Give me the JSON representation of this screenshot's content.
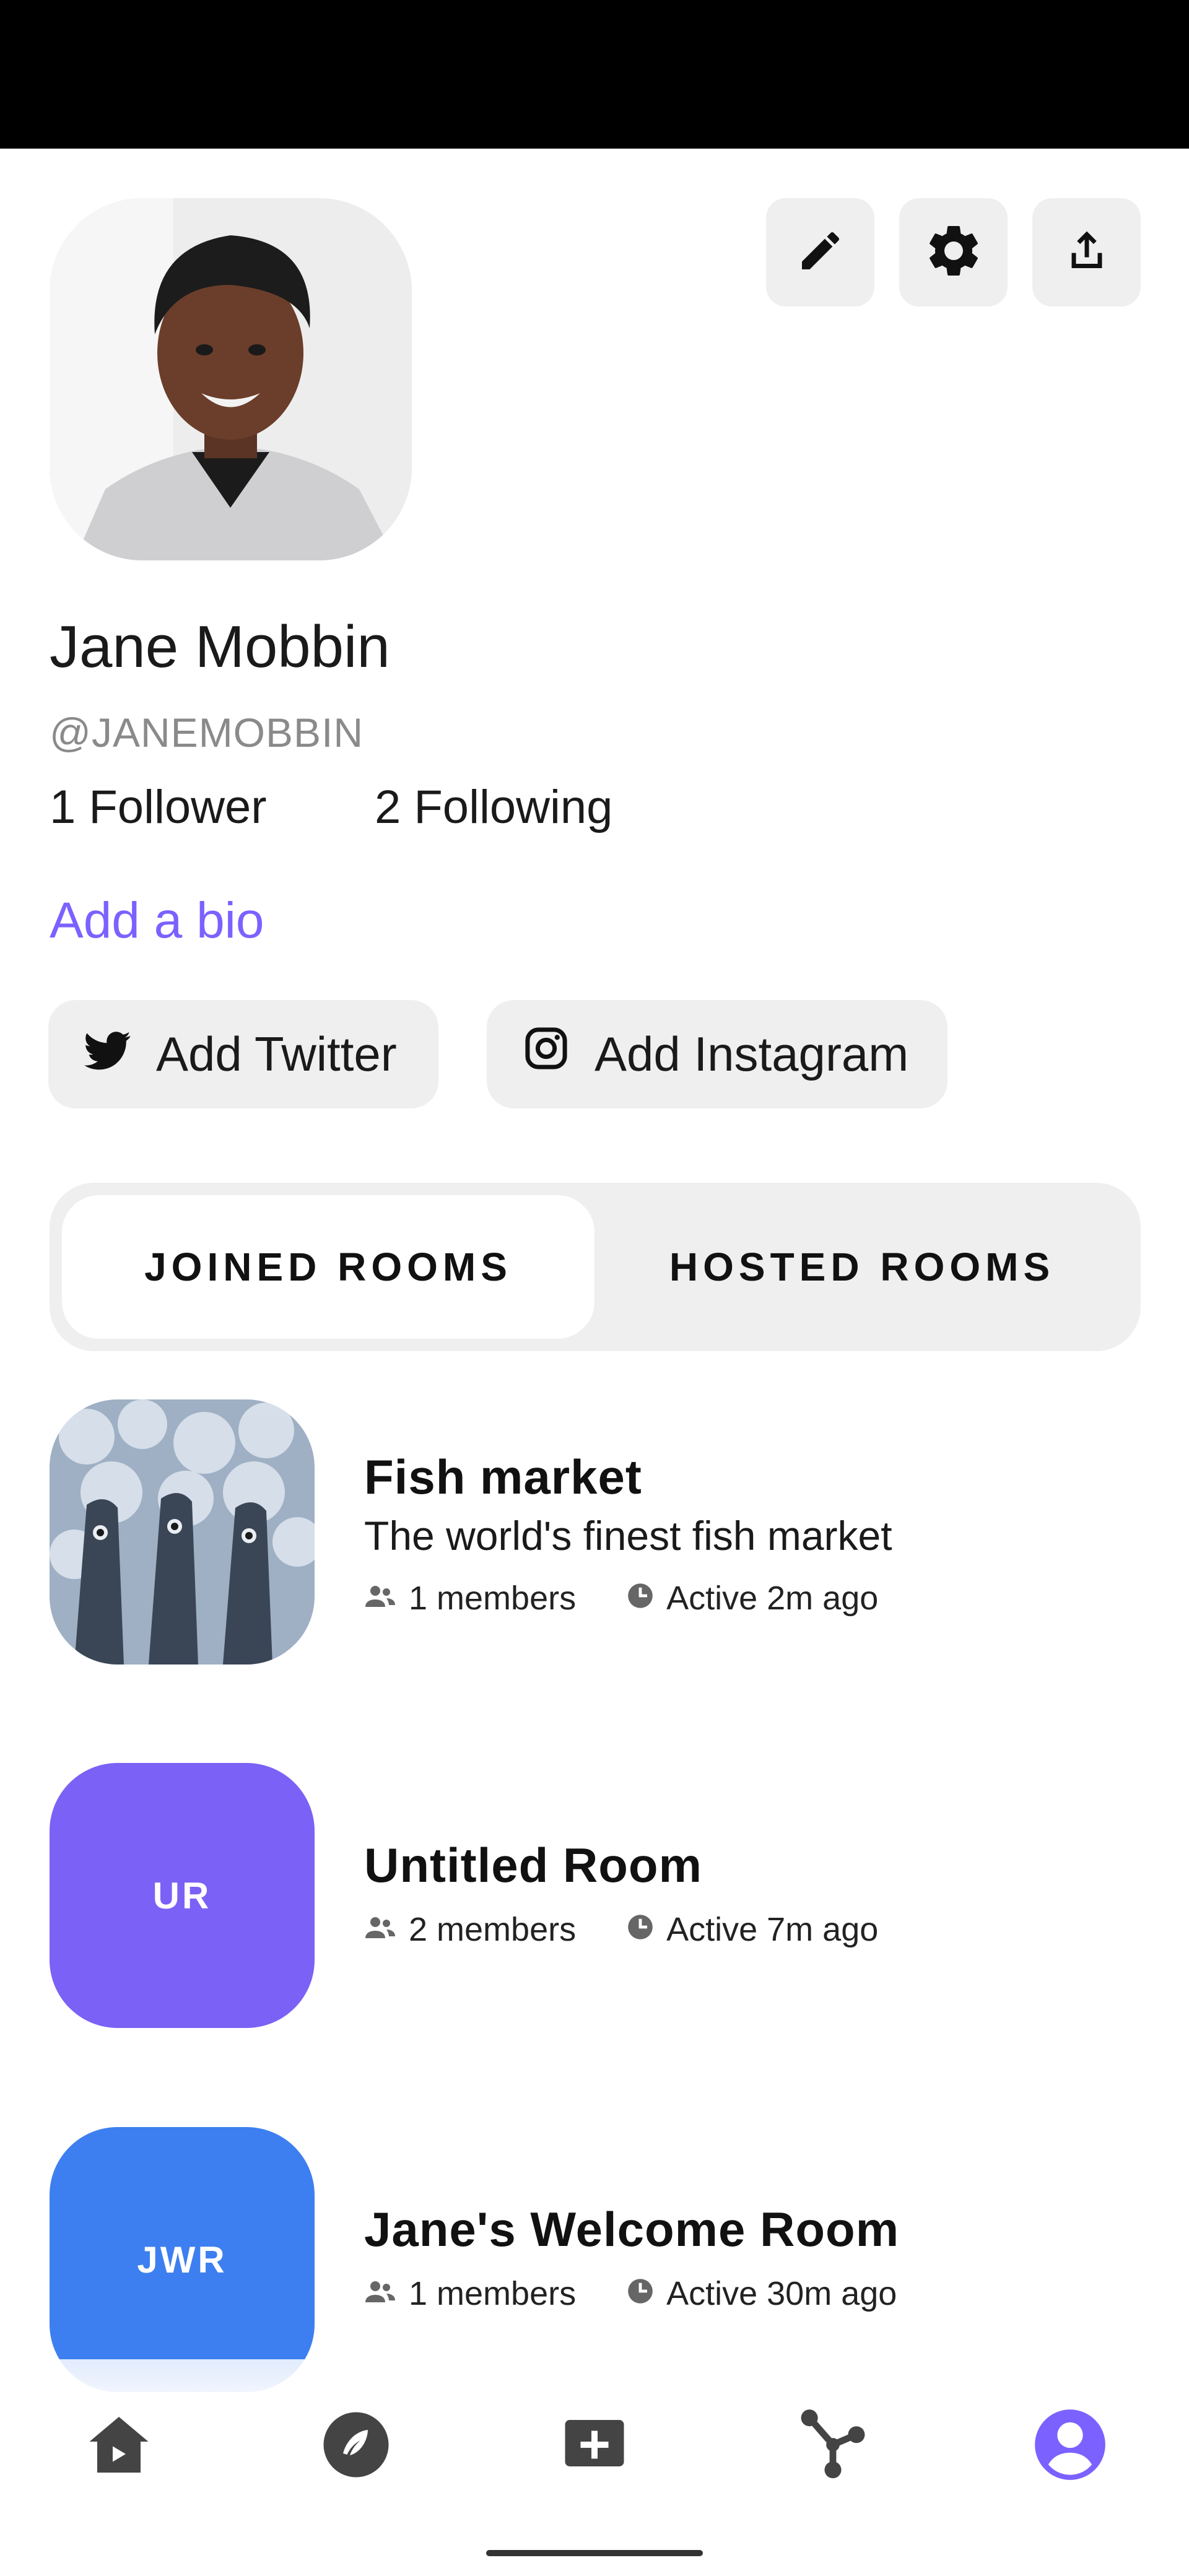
{
  "profile": {
    "name": "Jane Mobbin",
    "handle": "@JANEMOBBIN",
    "followers": "1 Follower",
    "following": "2 Following",
    "bio_prompt": "Add a bio"
  },
  "actions": {
    "edit_icon": "pencil-icon",
    "settings_icon": "gear-icon",
    "share_icon": "share-icon"
  },
  "social": {
    "twitter_label": "Add Twitter",
    "instagram_label": "Add Instagram"
  },
  "tabs": [
    {
      "label": "JOINED ROOMS",
      "active": true
    },
    {
      "label": "HOSTED ROOMS",
      "active": false
    }
  ],
  "rooms": [
    {
      "title": "Fish market",
      "description": "The world's finest fish market",
      "members": "1 members",
      "activity": "Active 2m ago",
      "initials": "",
      "color": ""
    },
    {
      "title": "Untitled Room",
      "description": "",
      "members": "2 members",
      "activity": "Active 7m ago",
      "initials": "UR",
      "color": "#7b61f5"
    },
    {
      "title": "Jane's Welcome Room",
      "description": "",
      "members": "1 members",
      "activity": "Active 30m ago",
      "initials": "JWR",
      "color": "#3d7ff0"
    }
  ],
  "nav": [
    "home-icon",
    "explore-icon",
    "create-room-icon",
    "network-icon",
    "profile-icon"
  ],
  "colors": {
    "accent": "#7b61ff",
    "chip_bg": "#efefef"
  }
}
